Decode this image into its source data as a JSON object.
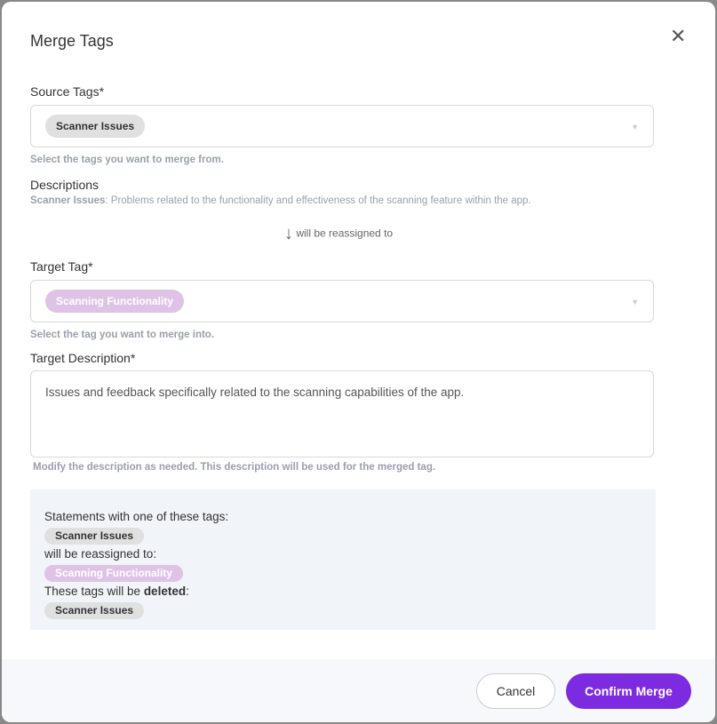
{
  "title": "Merge Tags",
  "source": {
    "label": "Source Tags*",
    "tag": "Scanner Issues",
    "help": "Select the tags you want to merge from."
  },
  "descriptions": {
    "label": "Descriptions",
    "tag": "Scanner Issues",
    "text": ": Problems related to the functionality and effectiveness of the scanning feature within the app."
  },
  "reassign_note": "will be reassigned to",
  "target": {
    "label": "Target Tag*",
    "tag": "Scanning Functionality",
    "help": "Select the tag you want to merge into."
  },
  "target_description": {
    "label": "Target Description*",
    "value": "Issues and feedback specifically related to the scanning capabilities of the app.",
    "help": "Modify the description as needed. This description will be used for the merged tag."
  },
  "summary": {
    "line1": "Statements with one of these tags:",
    "tag1": "Scanner Issues",
    "line2": "will be reassigned to:",
    "tag2": "Scanning Functionality",
    "line3a": "These tags will be ",
    "line3b": "deleted",
    "line3c": ":",
    "tag3": "Scanner Issues"
  },
  "buttons": {
    "cancel": "Cancel",
    "confirm": "Confirm Merge"
  },
  "colors": {
    "accent": "#7c2be0",
    "target_tag": "#dfc3e6",
    "source_tag": "#e0e0e0"
  }
}
